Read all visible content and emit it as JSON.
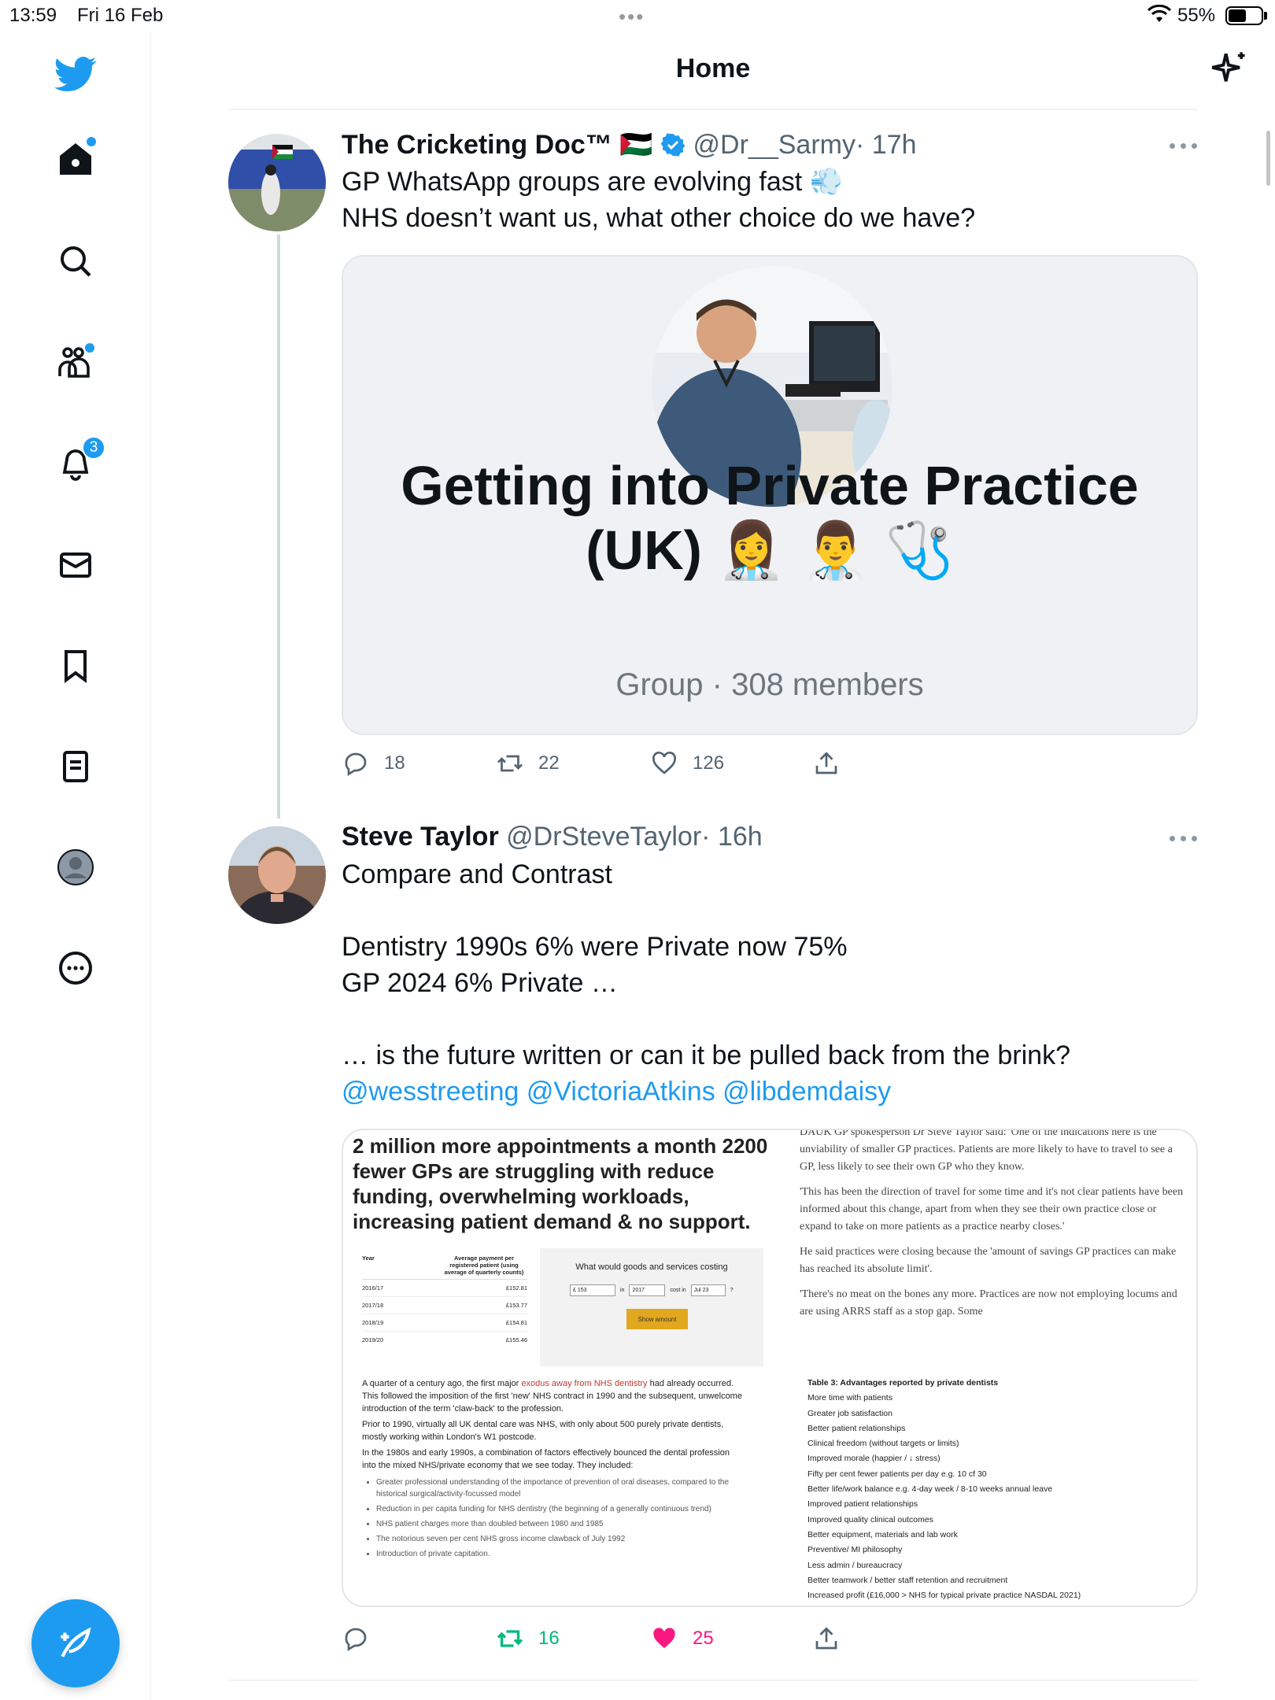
{
  "status_bar": {
    "time": "13:59",
    "date": "Fri 16 Feb",
    "battery": "55%"
  },
  "header": {
    "title": "Home"
  },
  "sidebar": {
    "notifications_badge": "3"
  },
  "tweet1": {
    "name": "The Cricketing Doc™",
    "flag": "🇵🇸",
    "handle": "@Dr__Sarmy",
    "time": "· 17h",
    "lines": [
      "GP WhatsApp groups are evolving fast 💨",
      "NHS doesn’t want us, what other choice do we have?"
    ],
    "card": {
      "title_line1": "Getting into Private Practice",
      "title_line2": "(UK) 👩‍⚕️ 👨‍⚕️ 🩺",
      "subtitle": "Group · 308 members"
    },
    "replies": "18",
    "retweets": "22",
    "likes": "126"
  },
  "tweet2": {
    "name": "Steve Taylor",
    "handle": "@DrSteveTaylor",
    "time": "· 16h",
    "lines": [
      "Compare and Contrast",
      "",
      "Dentistry 1990s 6% were Private now 75%",
      "GP 2024 6% Private …",
      "",
      "… is the future written or can it be pulled back from the brink?"
    ],
    "mentions": "@wesstreeting @VictoriaAtkins @libdemdaisy",
    "replies": "",
    "retweets": "16",
    "likes": "25",
    "image": {
      "headline": "2 million more appointments a month 2200 fewer GPs are struggling with reduce funding, overwhelming workloads, increasing patient demand & no support.",
      "table_headers": [
        "Year",
        "Average payment per registered patient (using average of quarterly counts)"
      ],
      "table_rows": [
        [
          "2016/17",
          "£152.81"
        ],
        [
          "2017/18",
          "£153.77"
        ],
        [
          "2018/19",
          "£154.81"
        ],
        [
          "2019/20",
          "£155.46"
        ]
      ],
      "calc_title": "What would goods and services costing",
      "calc_amount": "£ 153",
      "calc_in": "in",
      "calc_year": "2017",
      "calc_costin": "cost in",
      "calc_month": "Jul 23",
      "calc_q": "?",
      "calc_button": "Show amount",
      "quote_paragraphs": [
        "DAUK GP spokesperson Dr Steve Taylor said: 'One of the indications here is the unviability of smaller GP practices. Patients are more likely to have to travel to see a GP, less likely to see their own GP who they know.",
        "'This has been the direction of travel for some time and it's not clear patients have been informed about this change, apart from when they see their own practice close or expand to take on more patients as a practice nearby closes.'",
        "He said practices were closing because the 'amount of savings GP practices can make has reached its absolute limit'.",
        "'There's no meat on the bones any more. Practices are now not employing locums and are using ARRS staff as a stop gap. Some"
      ],
      "dental_p1_pre": "A quarter of a century ago, the first major ",
      "dental_p1_link": "exodus away from NHS dentistry",
      "dental_p1_post": " had already occurred. This followed the imposition of the first 'new' NHS contract in 1990 and the subsequent, unwelcome introduction of the term 'claw-back' to the profession.",
      "dental_p2": "Prior to 1990, virtually all UK dental care was NHS, with only about 500 purely private dentists, mostly working within London's W1 postcode.",
      "dental_p3": "In the 1980s and early 1990s, a combination of factors effectively bounced the dental profession into the mixed NHS/private economy that we see today. They included:",
      "dental_bullets": [
        "Greater professional understanding of the importance of prevention of oral diseases, compared to the historical surgical/activity-focussed model",
        "Reduction in per capita funding for NHS dentistry (the beginning of a generally continuous trend)",
        "NHS patient charges more than doubled between 1980 and 1985",
        "The notorious seven per cent NHS gross income clawback of July 1992",
        "Introduction of private capitation."
      ],
      "table3_title": "Table 3: Advantages reported by private dentists",
      "table3_items": [
        "More time with patients",
        "Greater job satisfaction",
        "Better patient relationships",
        "Clinical freedom (without targets or limits)",
        "Improved morale (happier / ↓ stress)",
        "Fifty per cent fewer patients per day e.g. 10 cf 30",
        "Better life/work balance e.g. 4-day week / 8-10 weeks annual leave",
        "Improved patient relationships",
        "Improved quality clinical outcomes",
        "Better equipment, materials and lab work",
        "Preventive/ MI philosophy",
        "Less admin / bureaucracy",
        "Better teamwork / better staff retention and recruitment",
        "Increased profit (£16,000 > NHS for typical private practice NASDAL 2021)"
      ]
    }
  },
  "colors": {
    "accent": "#1d9bf0",
    "retweet_green": "#00ba7c",
    "like_pink": "#f91880"
  }
}
